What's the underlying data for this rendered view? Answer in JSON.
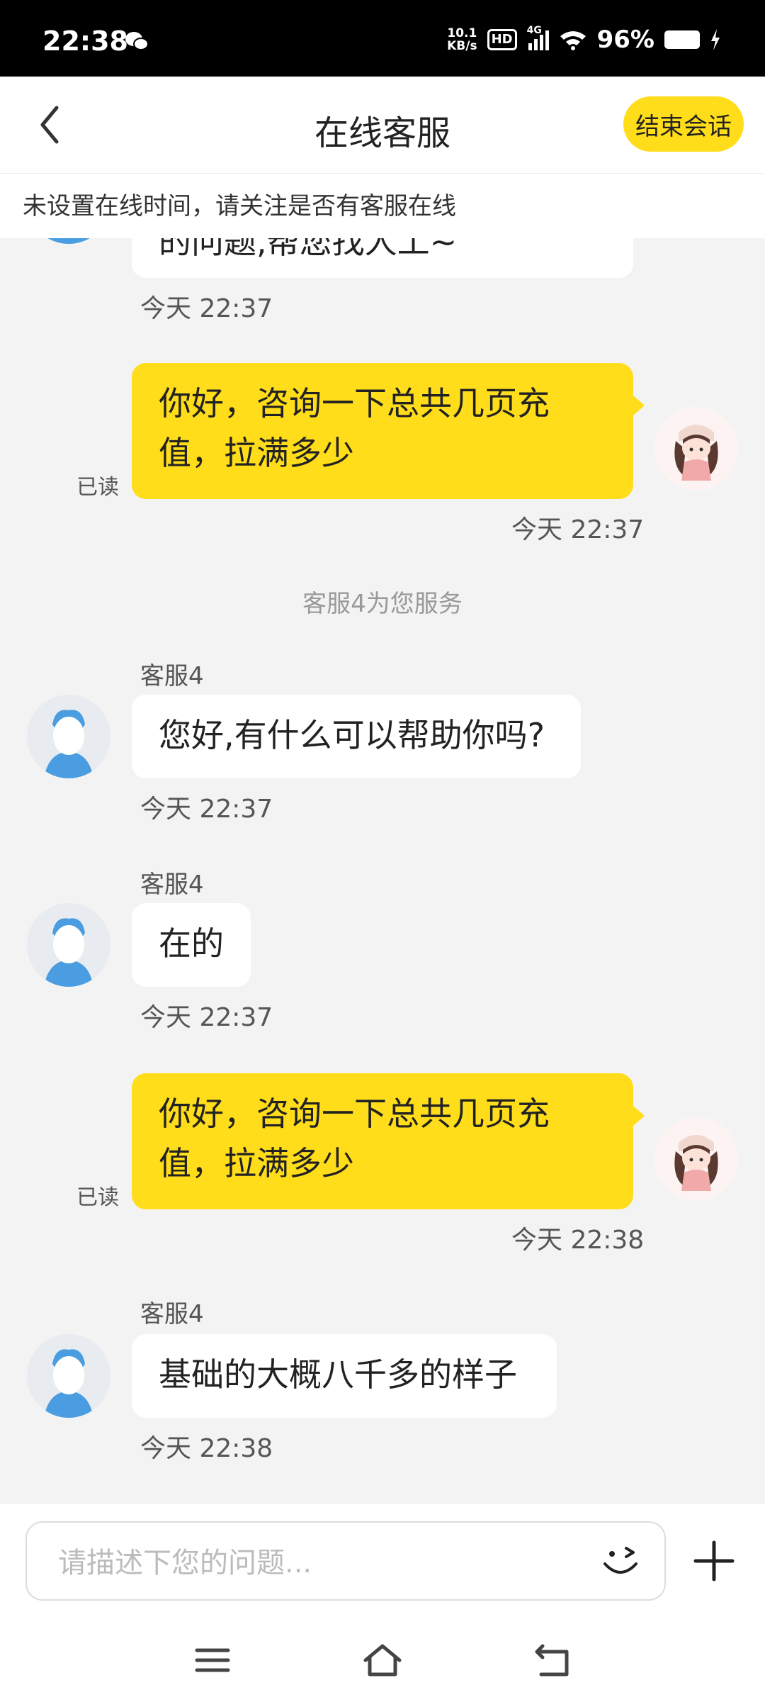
{
  "status_bar": {
    "time": "22:38",
    "net_speed_value": "10.1",
    "net_speed_unit": "KB/s",
    "hd_label": "HD",
    "network_type": "4G",
    "battery_percent": "96%"
  },
  "header": {
    "title": "在线客服",
    "end_session_label": "结束会话"
  },
  "notice": "未设置在线时间，请关注是否有客服在线",
  "messages": [
    {
      "type": "agent_partial",
      "text": "的问题,帮您找人工~",
      "time": "今天 22:37"
    },
    {
      "type": "user",
      "text_line1": "你好，咨询一下总共几页充",
      "text_line2": "值，拉满多少",
      "status": "已读",
      "time": "今天 22:37"
    },
    {
      "type": "system",
      "text": "客服4为您服务"
    },
    {
      "type": "agent",
      "name": "客服4",
      "text": "您好,有什么可以帮助你吗?",
      "time": "今天 22:37"
    },
    {
      "type": "agent",
      "name": "客服4",
      "text": "在的",
      "time": "今天 22:37"
    },
    {
      "type": "user",
      "text_line1": "你好，咨询一下总共几页充",
      "text_line2": "值，拉满多少",
      "status": "已读",
      "time": "今天 22:38"
    },
    {
      "type": "agent",
      "name": "客服4",
      "text": "基础的大概八千多的样子",
      "time": "今天 22:38"
    }
  ],
  "input": {
    "placeholder": "请描述下您的问题...",
    "value": ""
  },
  "icons": {
    "back": "chevron-left-icon",
    "emoji": "wink-emoji-icon",
    "plus": "plus-icon",
    "menu": "menu-icon",
    "home": "home-icon",
    "return": "back-gesture-icon"
  },
  "colors": {
    "accent": "#ffdd1a",
    "background": "#f3f3f3",
    "agent_bubble": "#ffffff"
  }
}
